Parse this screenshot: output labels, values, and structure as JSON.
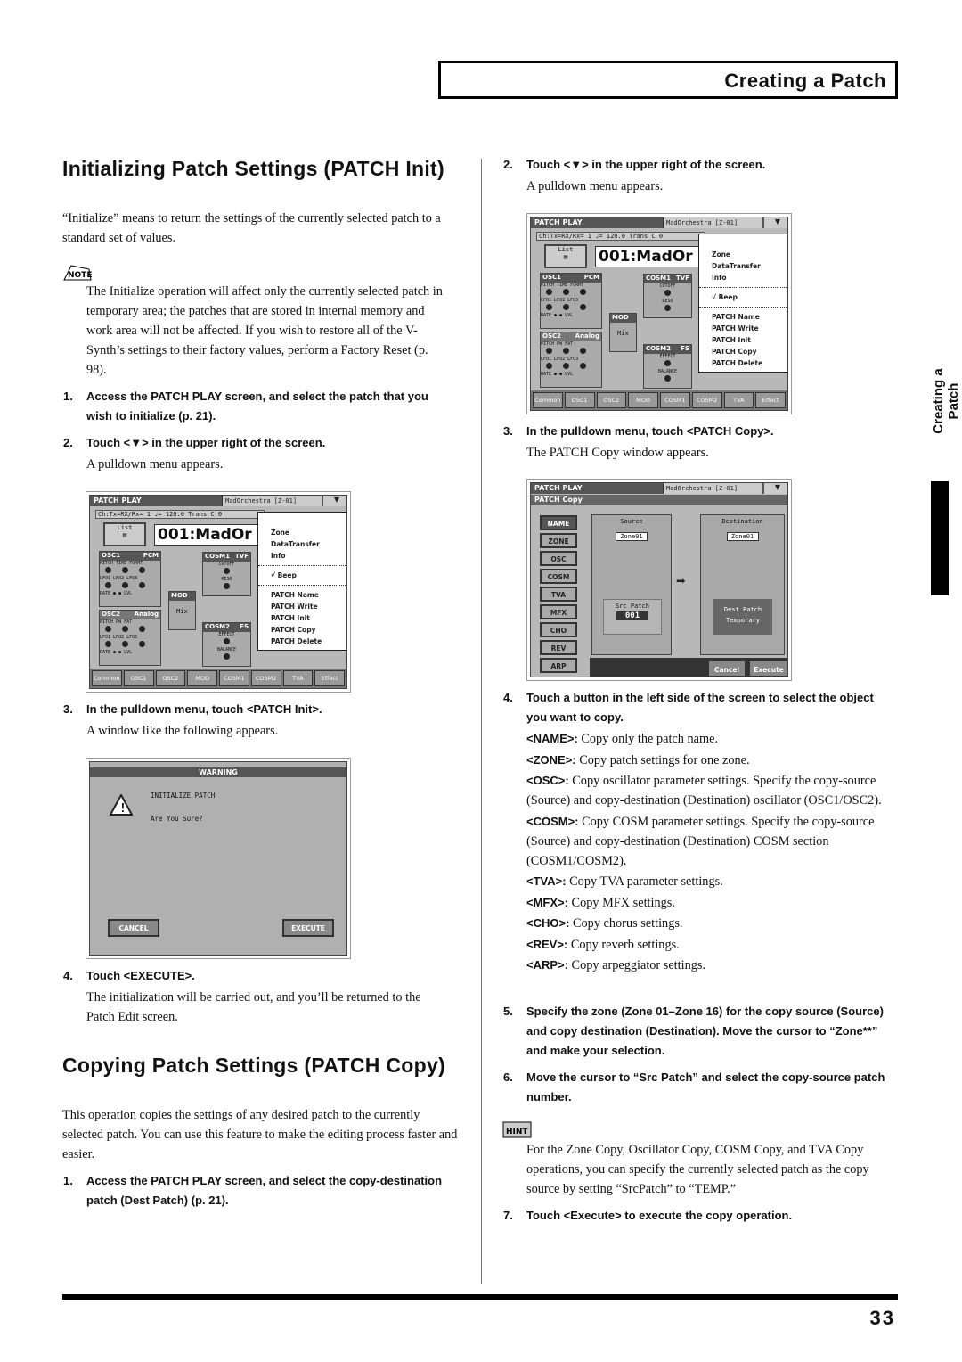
{
  "header": {
    "section": "Creating a Patch"
  },
  "side_tab": "Creating a Patch",
  "page_number": "33",
  "left": {
    "h_init": "Initializing Patch Settings (PATCH Init)",
    "init_intro": "“Initialize” means to return the settings of the currently selected patch to a standard set of values.",
    "note_label": "NOTE",
    "note_text": "The Initialize operation will affect only the currently selected patch in temporary area; the patches that are stored in internal memory and work area will not be affected. If you wish to restore all of the V-Synth’s settings to their factory values, perform a Factory Reset (p. 98).",
    "s1n": "1.",
    "s1": "Access the PATCH PLAY screen, and select the patch that you wish to initialize (p. 21).",
    "s2n": "2.",
    "s2": "Touch <▼> in the upper right of the screen.",
    "s2sub": "A pulldown menu appears.",
    "s3n": "3.",
    "s3": "In the pulldown menu, touch <PATCH Init>.",
    "s3sub": "A window like the following appears.",
    "s4n": "4.",
    "s4": "Touch <EXECUTE>.",
    "s4sub": "The initialization will be carried out, and you’ll be returned to the Patch Edit screen.",
    "h_copy": "Copying Patch Settings (PATCH Copy)",
    "copy_intro": "This operation copies the settings of any desired patch to the currently selected patch. You can use this feature to make the editing process faster and easier.",
    "c1n": "1.",
    "c1": "Access the PATCH PLAY screen, and select the copy-destination patch (Dest Patch) (p. 21)."
  },
  "right": {
    "s2n": "2.",
    "s2": "Touch <▼> in the upper right of the screen.",
    "s2sub": "A pulldown menu appears.",
    "s3n": "3.",
    "s3": "In the pulldown menu, touch <PATCH Copy>.",
    "s3sub": "The PATCH Copy window appears.",
    "s4n": "4.",
    "s4": "Touch a button in the left side of the screen to select the object you want to copy.",
    "defs": [
      {
        "k": "<NAME>:",
        "v": " Copy only the patch name."
      },
      {
        "k": "<ZONE>:",
        "v": " Copy patch settings for one zone."
      },
      {
        "k": "<OSC>:",
        "v": " Copy oscillator parameter settings. Specify the copy-source (Source) and copy-destination (Destination) oscillator (OSC1/OSC2)."
      },
      {
        "k": "<COSM>:",
        "v": " Copy COSM parameter settings. Specify the copy-source (Source) and copy-destination (Destination) COSM section (COSM1/COSM2)."
      },
      {
        "k": "<TVA>:",
        "v": " Copy TVA parameter settings."
      },
      {
        "k": "<MFX>:",
        "v": " Copy MFX settings."
      },
      {
        "k": "<CHO>:",
        "v": " Copy chorus settings."
      },
      {
        "k": "<REV>:",
        "v": " Copy reverb settings."
      },
      {
        "k": "<ARP>:",
        "v": " Copy arpeggiator settings."
      }
    ],
    "s5n": "5.",
    "s5": "Specify the zone (Zone 01–Zone 16) for the copy source (Source) and copy destination (Destination). Move the cursor to “Zone**” and make your selection.",
    "s6n": "6.",
    "s6": "Move the cursor to “Src Patch” and select the copy-source patch number.",
    "hint_label": "HINT",
    "hint_text": "For the Zone Copy, Oscillator Copy, COSM Copy, and TVA Copy operations, you can specify the currently selected patch as the copy source by setting “SrcPatch” to “TEMP.”",
    "s7n": "7.",
    "s7": "Touch <Execute> to execute the copy operation."
  },
  "screen_play": {
    "title": "PATCH PLAY",
    "patch_name": "MadOrchestra [Z-01]",
    "arrow": "▼",
    "status": "Ch:Tx=RX/Rx= 1  ♩= 120.0 Trans  C 0",
    "list": "List",
    "patch_big": "001:MadOr",
    "osc1": "OSC1",
    "osc1_type": "PCM",
    "osc1_labels": "PITCH TIME FORMT",
    "lfo": "LFO1 LFO2 LFO3",
    "rate": "RATE",
    "lvl": "LVL",
    "osc2": "OSC2",
    "osc2_type": "Analog",
    "osc2_labels": "PITCH  PW   FAT",
    "mod": "MOD",
    "mod_val": "Mix",
    "cosm1": "COSM1",
    "cosm1_type": "TVF",
    "cutoff": "CUTOFF",
    "reso": "RESO",
    "cosm2": "COSM2",
    "cosm2_type": "FS",
    "effect": "EFFECT",
    "balance": "BALANCE",
    "menu": [
      "Zone",
      "DataTransfer",
      "Info",
      "√ Beep",
      "PATCH Name",
      "PATCH Write",
      "PATCH Init",
      "PATCH Copy",
      "PATCH Delete"
    ],
    "tabs": [
      "Common",
      "OSC1",
      "OSC2",
      "MOD",
      "COSM1",
      "COSM2",
      "TVA",
      "Effect"
    ]
  },
  "screen_warn": {
    "title": "WARNING",
    "line1": "INITIALIZE PATCH",
    "line2": "Are You Sure?",
    "cancel": "CANCEL",
    "execute": "EXECUTE"
  },
  "screen_copy": {
    "title": "PATCH PLAY",
    "patch_name": "MadOrchestra [Z-01]",
    "arrow": "▼",
    "subtitle": "PATCH Copy",
    "buttons": [
      "NAME",
      "ZONE",
      "OSC",
      "COSM",
      "TVA",
      "MFX",
      "CHO",
      "REV",
      "ARP"
    ],
    "source": "Source",
    "destination": "Destination",
    "zone_src": "Zone01",
    "zone_dst": "Zone01",
    "src_patch": "Src Patch",
    "src_num": "001",
    "dest_patch": "Dest Patch",
    "dest_val": "Temporary",
    "cancel": "Cancel",
    "execute": "Execute"
  }
}
